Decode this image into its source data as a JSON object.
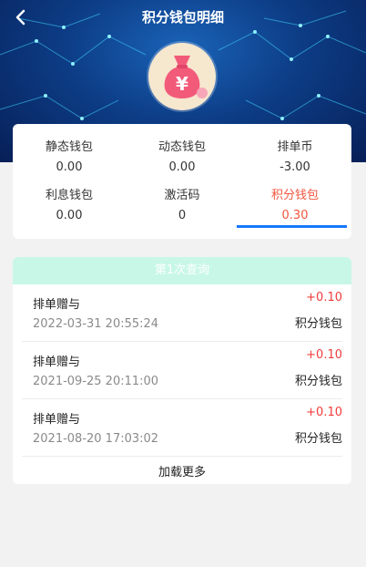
{
  "header": {
    "title": "积分钱包明细"
  },
  "colors": {
    "accent": "#1677ff",
    "active_text": "#f2553d",
    "amount": "#f23c3c"
  },
  "wallets": [
    {
      "label": "静态钱包",
      "value": "0.00"
    },
    {
      "label": "动态钱包",
      "value": "0.00"
    },
    {
      "label": "排单币",
      "value": "-3.00"
    },
    {
      "label": "利息钱包",
      "value": "0.00"
    },
    {
      "label": "激活码",
      "value": "0"
    },
    {
      "label": "积分钱包",
      "value": "0.30",
      "active": true
    }
  ],
  "records": {
    "header": "第1次查询",
    "items": [
      {
        "name": "排单赠与",
        "time": "2022-03-31 20:55:24",
        "amount": "+0.10",
        "wallet": "积分钱包"
      },
      {
        "name": "排单赠与",
        "time": "2021-09-25 20:11:00",
        "amount": "+0.10",
        "wallet": "积分钱包"
      },
      {
        "name": "排单赠与",
        "time": "2021-08-20 17:03:02",
        "amount": "+0.10",
        "wallet": "积分钱包"
      }
    ],
    "load_more": "加载更多"
  }
}
